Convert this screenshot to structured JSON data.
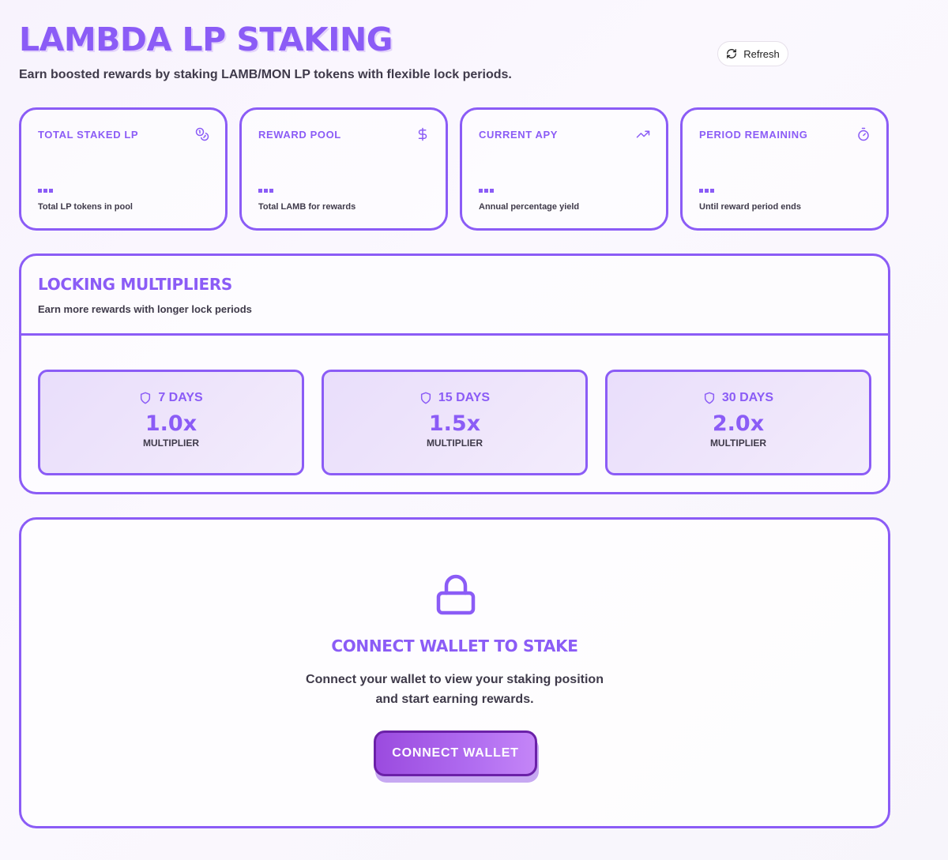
{
  "header": {
    "title": "LAMBDA LP STAKING",
    "subtitle": "Earn boosted rewards by staking LAMB/MON LP tokens with flexible lock periods.",
    "refresh_label": "Refresh"
  },
  "stats": [
    {
      "label": "TOTAL STAKED LP",
      "icon": "coins-icon",
      "value": "",
      "description": "Total LP tokens in pool"
    },
    {
      "label": "REWARD POOL",
      "icon": "dollar-icon",
      "value": "",
      "description": "Total LAMB for rewards"
    },
    {
      "label": "CURRENT APY",
      "icon": "trending-up-icon",
      "value": "",
      "description": "Annual percentage yield"
    },
    {
      "label": "PERIOD REMAINING",
      "icon": "timer-icon",
      "value": "",
      "description": "Until reward period ends"
    }
  ],
  "multipliers": {
    "title": "LOCKING MULTIPLIERS",
    "subtitle": "Earn more rewards with longer lock periods",
    "items": [
      {
        "days": "7 DAYS",
        "value": "1.0x",
        "caption": "MULTIPLIER"
      },
      {
        "days": "15 DAYS",
        "value": "1.5x",
        "caption": "MULTIPLIER"
      },
      {
        "days": "30 DAYS",
        "value": "2.0x",
        "caption": "MULTIPLIER"
      }
    ]
  },
  "connect": {
    "title": "CONNECT WALLET TO STAKE",
    "text_line1": "Connect your wallet to view your staking position",
    "text_line2": "and start earning rewards.",
    "button_label": "CONNECT WALLET"
  },
  "colors": {
    "accent": "#8b5cf6",
    "button_border": "#6b21a8",
    "text": "#3f3a4a"
  }
}
